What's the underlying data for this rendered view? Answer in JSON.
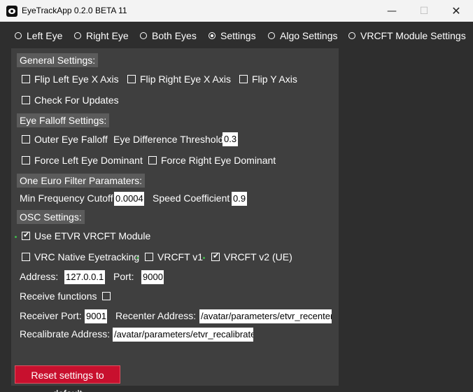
{
  "window": {
    "title": "EyeTrackApp 0.2.0 BETA 11",
    "min_glyph": "—",
    "max_glyph": "☐",
    "close_glyph": "✕",
    "icon": "eye-app-icon"
  },
  "tabs": [
    {
      "label": "Left Eye",
      "selected": false
    },
    {
      "label": "Right Eye",
      "selected": false
    },
    {
      "label": "Both Eyes",
      "selected": false
    },
    {
      "label": "Settings",
      "selected": true
    },
    {
      "label": "Algo Settings",
      "selected": false
    },
    {
      "label": "VRCFT Module Settings",
      "selected": false
    }
  ],
  "general": {
    "header": "General Settings:",
    "flip_left_x": "Flip Left Eye X Axis",
    "flip_right_x": "Flip Right Eye X Axis",
    "flip_y": "Flip Y Axis",
    "check_updates": "Check For Updates"
  },
  "falloff": {
    "header": "Eye Falloff Settings:",
    "outer_falloff": "Outer Eye Falloff",
    "diff_threshold_label": "Eye Difference Threshold",
    "diff_threshold_value": "0.3",
    "force_left": "Force Left Eye Dominant",
    "force_right": "Force Right Eye Dominant"
  },
  "euro": {
    "header": "One Euro Filter Paramaters:",
    "min_freq_label": "Min Frequency Cutoff",
    "min_freq_value": "0.0004",
    "speed_label": "Speed Coefficient",
    "speed_value": "0.9"
  },
  "osc": {
    "header": "OSC Settings:",
    "use_etvr": "Use ETVR VRCFT Module",
    "use_etvr_checked": true,
    "vrc_native": "VRC Native Eyetracking",
    "vrcft_v1": "VRCFT v1",
    "vrcft_v2": "VRCFT v2 (UE)",
    "vrcft_v2_checked": true,
    "address_label": "Address:",
    "address_value": "127.0.0.1",
    "port_label": "Port:",
    "port_value": "9000",
    "receive_label": "Receive functions",
    "receiver_port_label": "Receiver Port:",
    "receiver_port_value": "9001",
    "recenter_label": "Recenter Address:",
    "recenter_value": "/avatar/parameters/etvr_recenter",
    "recalibrate_label": "Recalibrate Address:",
    "recalibrate_value": "/avatar/parameters/etvr_recalibrate"
  },
  "reset_button": "Reset settings to default",
  "colors": {
    "background": "#2e2e2e",
    "panel": "#3f3f3f",
    "section_header": "#5b5b5b",
    "reset_button": "#c8102e",
    "active_dot": "#3fb74a"
  }
}
